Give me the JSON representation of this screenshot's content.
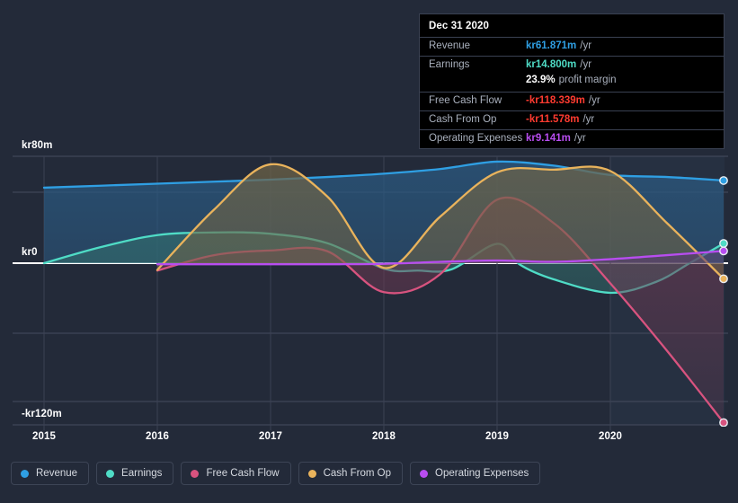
{
  "chart_data": {
    "type": "area",
    "title": "",
    "xlabel": "",
    "ylabel": "",
    "currency_prefix": "kr",
    "units": "m",
    "x_tick_labels": [
      "2015",
      "2016",
      "2017",
      "2018",
      "2019",
      "2020"
    ],
    "x_tick_values": [
      2015,
      2016,
      2017,
      2018,
      2019,
      2020
    ],
    "y_tick_labels": [
      "kr80m",
      "kr0",
      "-kr120m"
    ],
    "y_tick_values": [
      80,
      0,
      -120
    ],
    "ylim": [
      -120,
      93
    ],
    "xlim": [
      2015,
      2021.0
    ],
    "grid": true,
    "legend_position": "bottom",
    "zero_line": 0,
    "series": [
      {
        "name": "Revenue",
        "color": "#2f9fe3",
        "fill": "#2b5a82",
        "x": [
          2015.0,
          2015.5,
          2016.0,
          2016.5,
          2017.0,
          2017.5,
          2018.0,
          2018.5,
          2019.0,
          2019.5,
          2020.0,
          2020.5,
          2021.0
        ],
        "values": [
          56.5,
          58.0,
          59.5,
          61.0,
          62.5,
          64.5,
          67.0,
          70.5,
          76.0,
          73.0,
          66.0,
          64.5,
          61.871
        ]
      },
      {
        "name": "Earnings",
        "color": "#4fdcc6",
        "fill": "#33706e",
        "x": [
          2015.0,
          2015.5,
          2016.0,
          2016.5,
          2017.0,
          2017.5,
          2018.0,
          2018.3,
          2018.6,
          2019.0,
          2019.2,
          2019.5,
          2020.0,
          2020.4,
          2020.7,
          2021.0
        ],
        "values": [
          0.0,
          12.0,
          21.0,
          23.0,
          22.0,
          15.0,
          -4.0,
          -5.5,
          -4.5,
          14.5,
          -1.0,
          -12.0,
          -22.0,
          -14.0,
          0.0,
          14.8
        ]
      },
      {
        "name": "Free Cash Flow",
        "color": "#d8537f",
        "fill": "#6e3a52",
        "x": [
          2016.0,
          2016.5,
          2017.0,
          2017.5,
          2018.0,
          2018.5,
          2019.0,
          2019.5,
          2020.0,
          2020.5,
          2021.0
        ],
        "values": [
          -5.5,
          6.0,
          9.5,
          9.0,
          -21.5,
          -8.0,
          47.5,
          30.0,
          -15.0,
          -65.0,
          -118.339
        ]
      },
      {
        "name": "Cash From Op",
        "color": "#e9b35c",
        "fill": "#6d6347",
        "x": [
          2016.0,
          2016.5,
          2017.0,
          2017.5,
          2018.0,
          2018.5,
          2019.0,
          2019.5,
          2020.0,
          2020.5,
          2021.0
        ],
        "values": [
          -5.0,
          40.0,
          74.0,
          50.0,
          -3.5,
          35.0,
          68.0,
          70.0,
          69.0,
          30.0,
          -11.578
        ]
      },
      {
        "name": "Operating Expenses",
        "color": "#b84df0",
        "fill": "#5b3a73",
        "x": [
          2016.0,
          2016.5,
          2017.0,
          2017.5,
          2018.0,
          2018.5,
          2019.0,
          2019.5,
          2020.0,
          2020.5,
          2021.0
        ],
        "values": [
          -0.8,
          -0.8,
          -0.8,
          -0.8,
          -0.5,
          1.0,
          2.0,
          1.0,
          3.0,
          6.0,
          9.141
        ]
      }
    ]
  },
  "tooltip": {
    "title": "Dec 31 2020",
    "rows": [
      {
        "label": "Revenue",
        "value": "kr61.871m",
        "unit": "/yr",
        "color": "#2f9fe3"
      },
      {
        "label": "Earnings",
        "value": "kr14.800m",
        "unit": "/yr",
        "color": "#4fdcc6"
      },
      {
        "label": "",
        "value": "23.9%",
        "unit": "profit margin",
        "color": "#ffffff"
      },
      {
        "label": "Free Cash Flow",
        "value": "-kr118.339m",
        "unit": "/yr",
        "color": "#ff3b30"
      },
      {
        "label": "Cash From Op",
        "value": "-kr11.578m",
        "unit": "/yr",
        "color": "#ff3b30"
      },
      {
        "label": "Operating Expenses",
        "value": "kr9.141m",
        "unit": "/yr",
        "color": "#b84df0"
      }
    ]
  },
  "legend": {
    "items": [
      {
        "label": "Revenue",
        "color": "#2f9fe3"
      },
      {
        "label": "Earnings",
        "color": "#4fdcc6"
      },
      {
        "label": "Free Cash Flow",
        "color": "#d8537f"
      },
      {
        "label": "Cash From Op",
        "color": "#e9b35c"
      },
      {
        "label": "Operating Expenses",
        "color": "#b84df0"
      }
    ]
  },
  "axis": {
    "y_labels": [
      {
        "text": "kr80m",
        "value": 80
      },
      {
        "text": "kr0",
        "value": 0
      },
      {
        "text": "-kr120m",
        "value": -120
      }
    ],
    "x_labels": [
      {
        "text": "2015",
        "value": 2015
      },
      {
        "text": "2016",
        "value": 2016
      },
      {
        "text": "2017",
        "value": 2017
      },
      {
        "text": "2018",
        "value": 2018
      },
      {
        "text": "2019",
        "value": 2019
      },
      {
        "text": "2020",
        "value": 2020
      }
    ]
  },
  "colors": {
    "background": "#232a39",
    "grid": "#454c5e",
    "zero_line": "#ffffff",
    "panel_highlight": "#28304000"
  }
}
